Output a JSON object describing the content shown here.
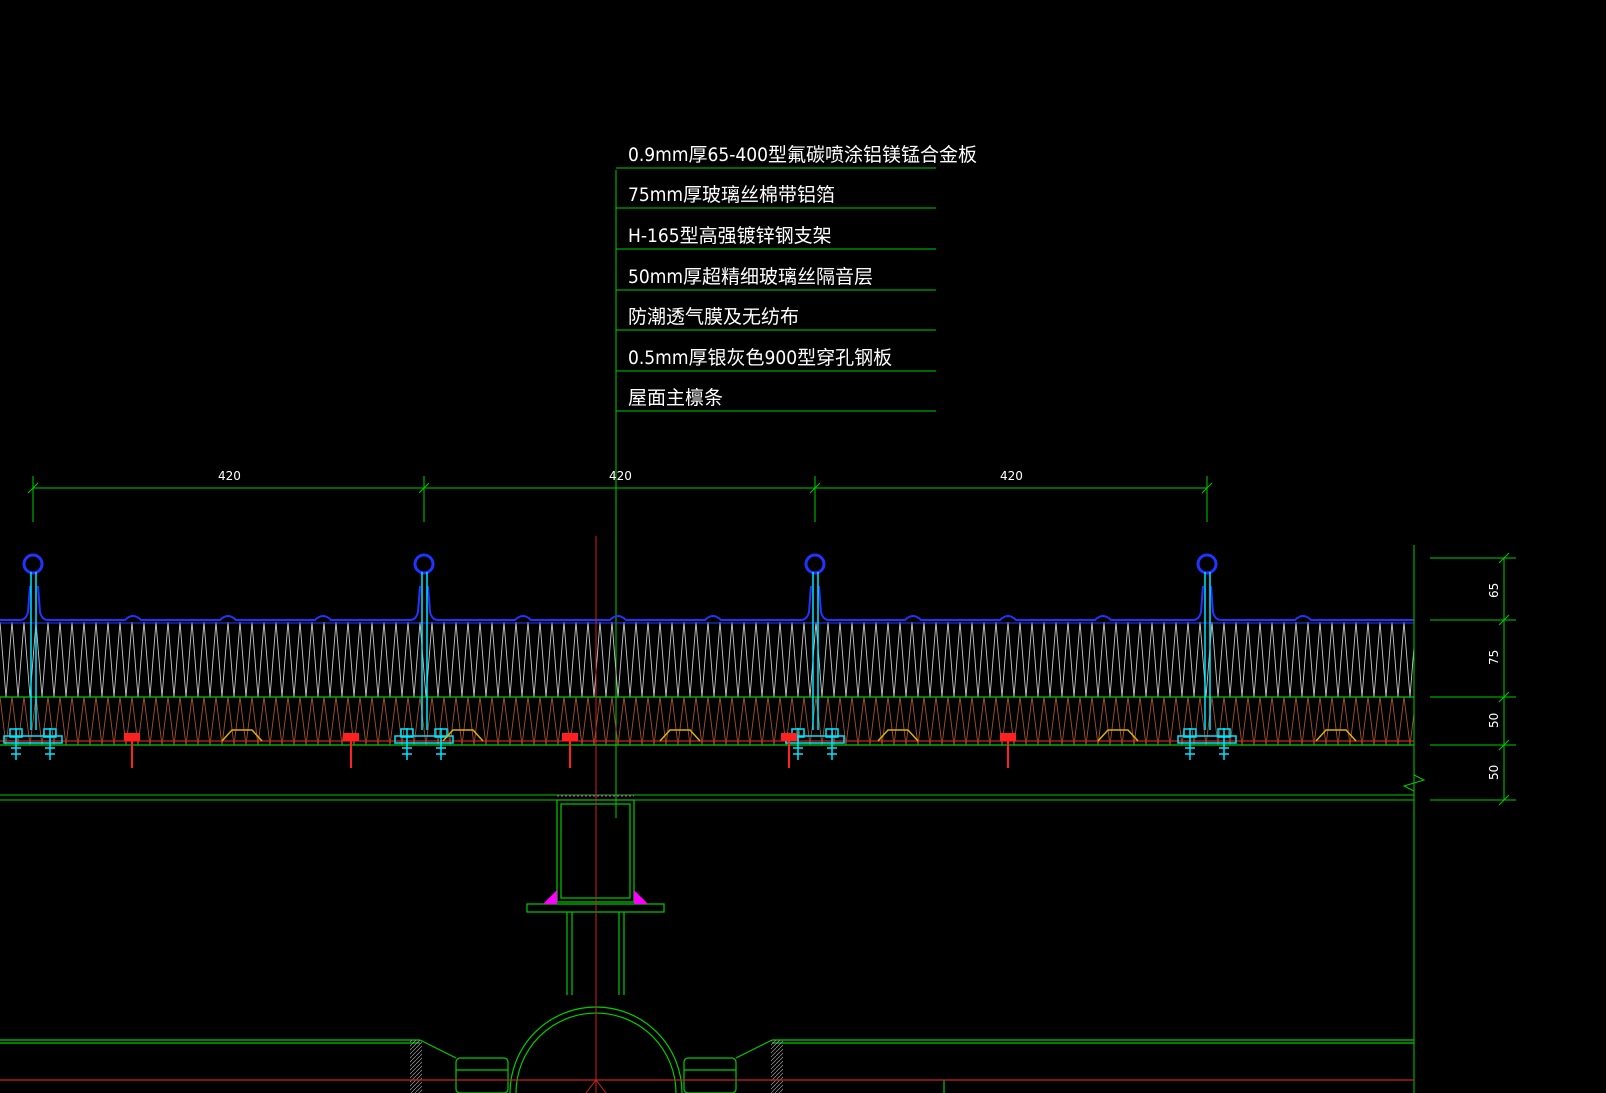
{
  "drawing": {
    "background": "#000000",
    "colors": {
      "leader": "#00cc00",
      "panel": "#2233ff",
      "insulation": "#c8c8c8",
      "acoustic": "#a0522d",
      "bracket": "#00e5ff",
      "screw": "#ff2020",
      "pad": "#e0b000",
      "centerline": "#cc2222",
      "weld": "#ff00ff",
      "structure": "#00cc00"
    },
    "layer_labels": [
      "0.9mm厚65-400型氟碳喷涂铝镁锰合金板",
      "75mm厚玻璃丝棉带铝箔",
      "H-165型高强镀锌钢支架",
      "50mm厚超精细玻璃丝隔音层",
      "防潮透气膜及无纺布",
      "0.5mm厚银灰色900型穿孔钢板",
      "屋面主檩条"
    ],
    "top_dimensions": [
      "420",
      "420",
      "420"
    ],
    "right_dimensions": [
      "65",
      "75",
      "50",
      "50"
    ]
  }
}
